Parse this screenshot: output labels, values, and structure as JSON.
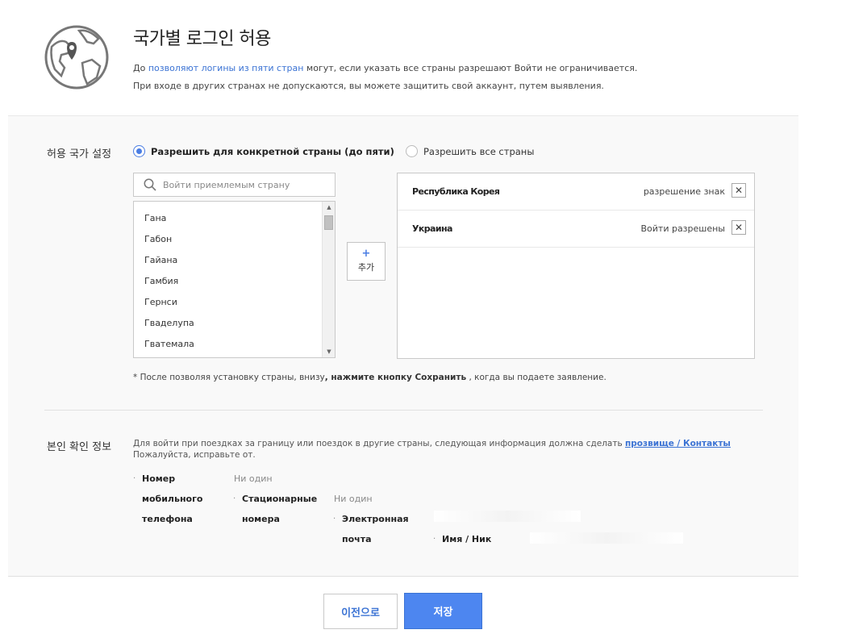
{
  "header": {
    "title": "국가별 로그인 허용",
    "desc_prefix": "До",
    "desc_link": "позволяют логины из пяти стран",
    "desc_suffix": "могут, если указать все страны разрешают Войти не ограничивается.",
    "desc_line2": "При входе в других странах не допускаются, вы можете защитить свой аккаунт, путем выявления."
  },
  "country_setting": {
    "label": "허용 국가 설정",
    "radio_specific": "Разрешить для конкретной страны (до пяти)",
    "radio_all": "Разрешить все страны",
    "selected_option": "specific",
    "search_placeholder": "Войти приемлемым страну",
    "countries": [
      "Гана",
      "Габон",
      "Гайана",
      "Гамбия",
      "Гернси",
      "Гваделупа",
      "Гватемала"
    ],
    "add_button": {
      "plus": "+",
      "label": "추가"
    },
    "selected": [
      {
        "name": "Республика Корея",
        "status": "разрешение знак",
        "remove": "✕"
      },
      {
        "name": "Украина",
        "status": "Войти разрешены",
        "remove": "✕"
      }
    ],
    "note_prefix": "* После позволяя установку страны, внизу",
    "note_bold": ", нажмите кнопку Сохранить",
    "note_suffix": ", когда вы подаете заявление."
  },
  "verification": {
    "label": "본인 확인 정보",
    "text_prefix": "Для войти при поездках за границу или поездок в другие страны, следующая информация должна сделать",
    "text_link": "прозвище / Контакты",
    "text_suffix": "Пожалуйста, исправьте от.",
    "mobile_label_1": "Номер",
    "mobile_label_2": "мобильного",
    "mobile_label_3": "телефона",
    "mobile_value": "Ни один",
    "landline_label_1": "Стационарные",
    "landline_label_2": "номера",
    "landline_value": "Ни один",
    "email_label_1": "Электронная",
    "email_label_2": "почта",
    "name_label": "Имя / Ник",
    "bullet": "·"
  },
  "buttons": {
    "prev": "이전으로",
    "save": "저장"
  },
  "colors": {
    "accent": "#4a7de3",
    "link": "#3b73d4",
    "save_bg": "#4d86f0"
  }
}
